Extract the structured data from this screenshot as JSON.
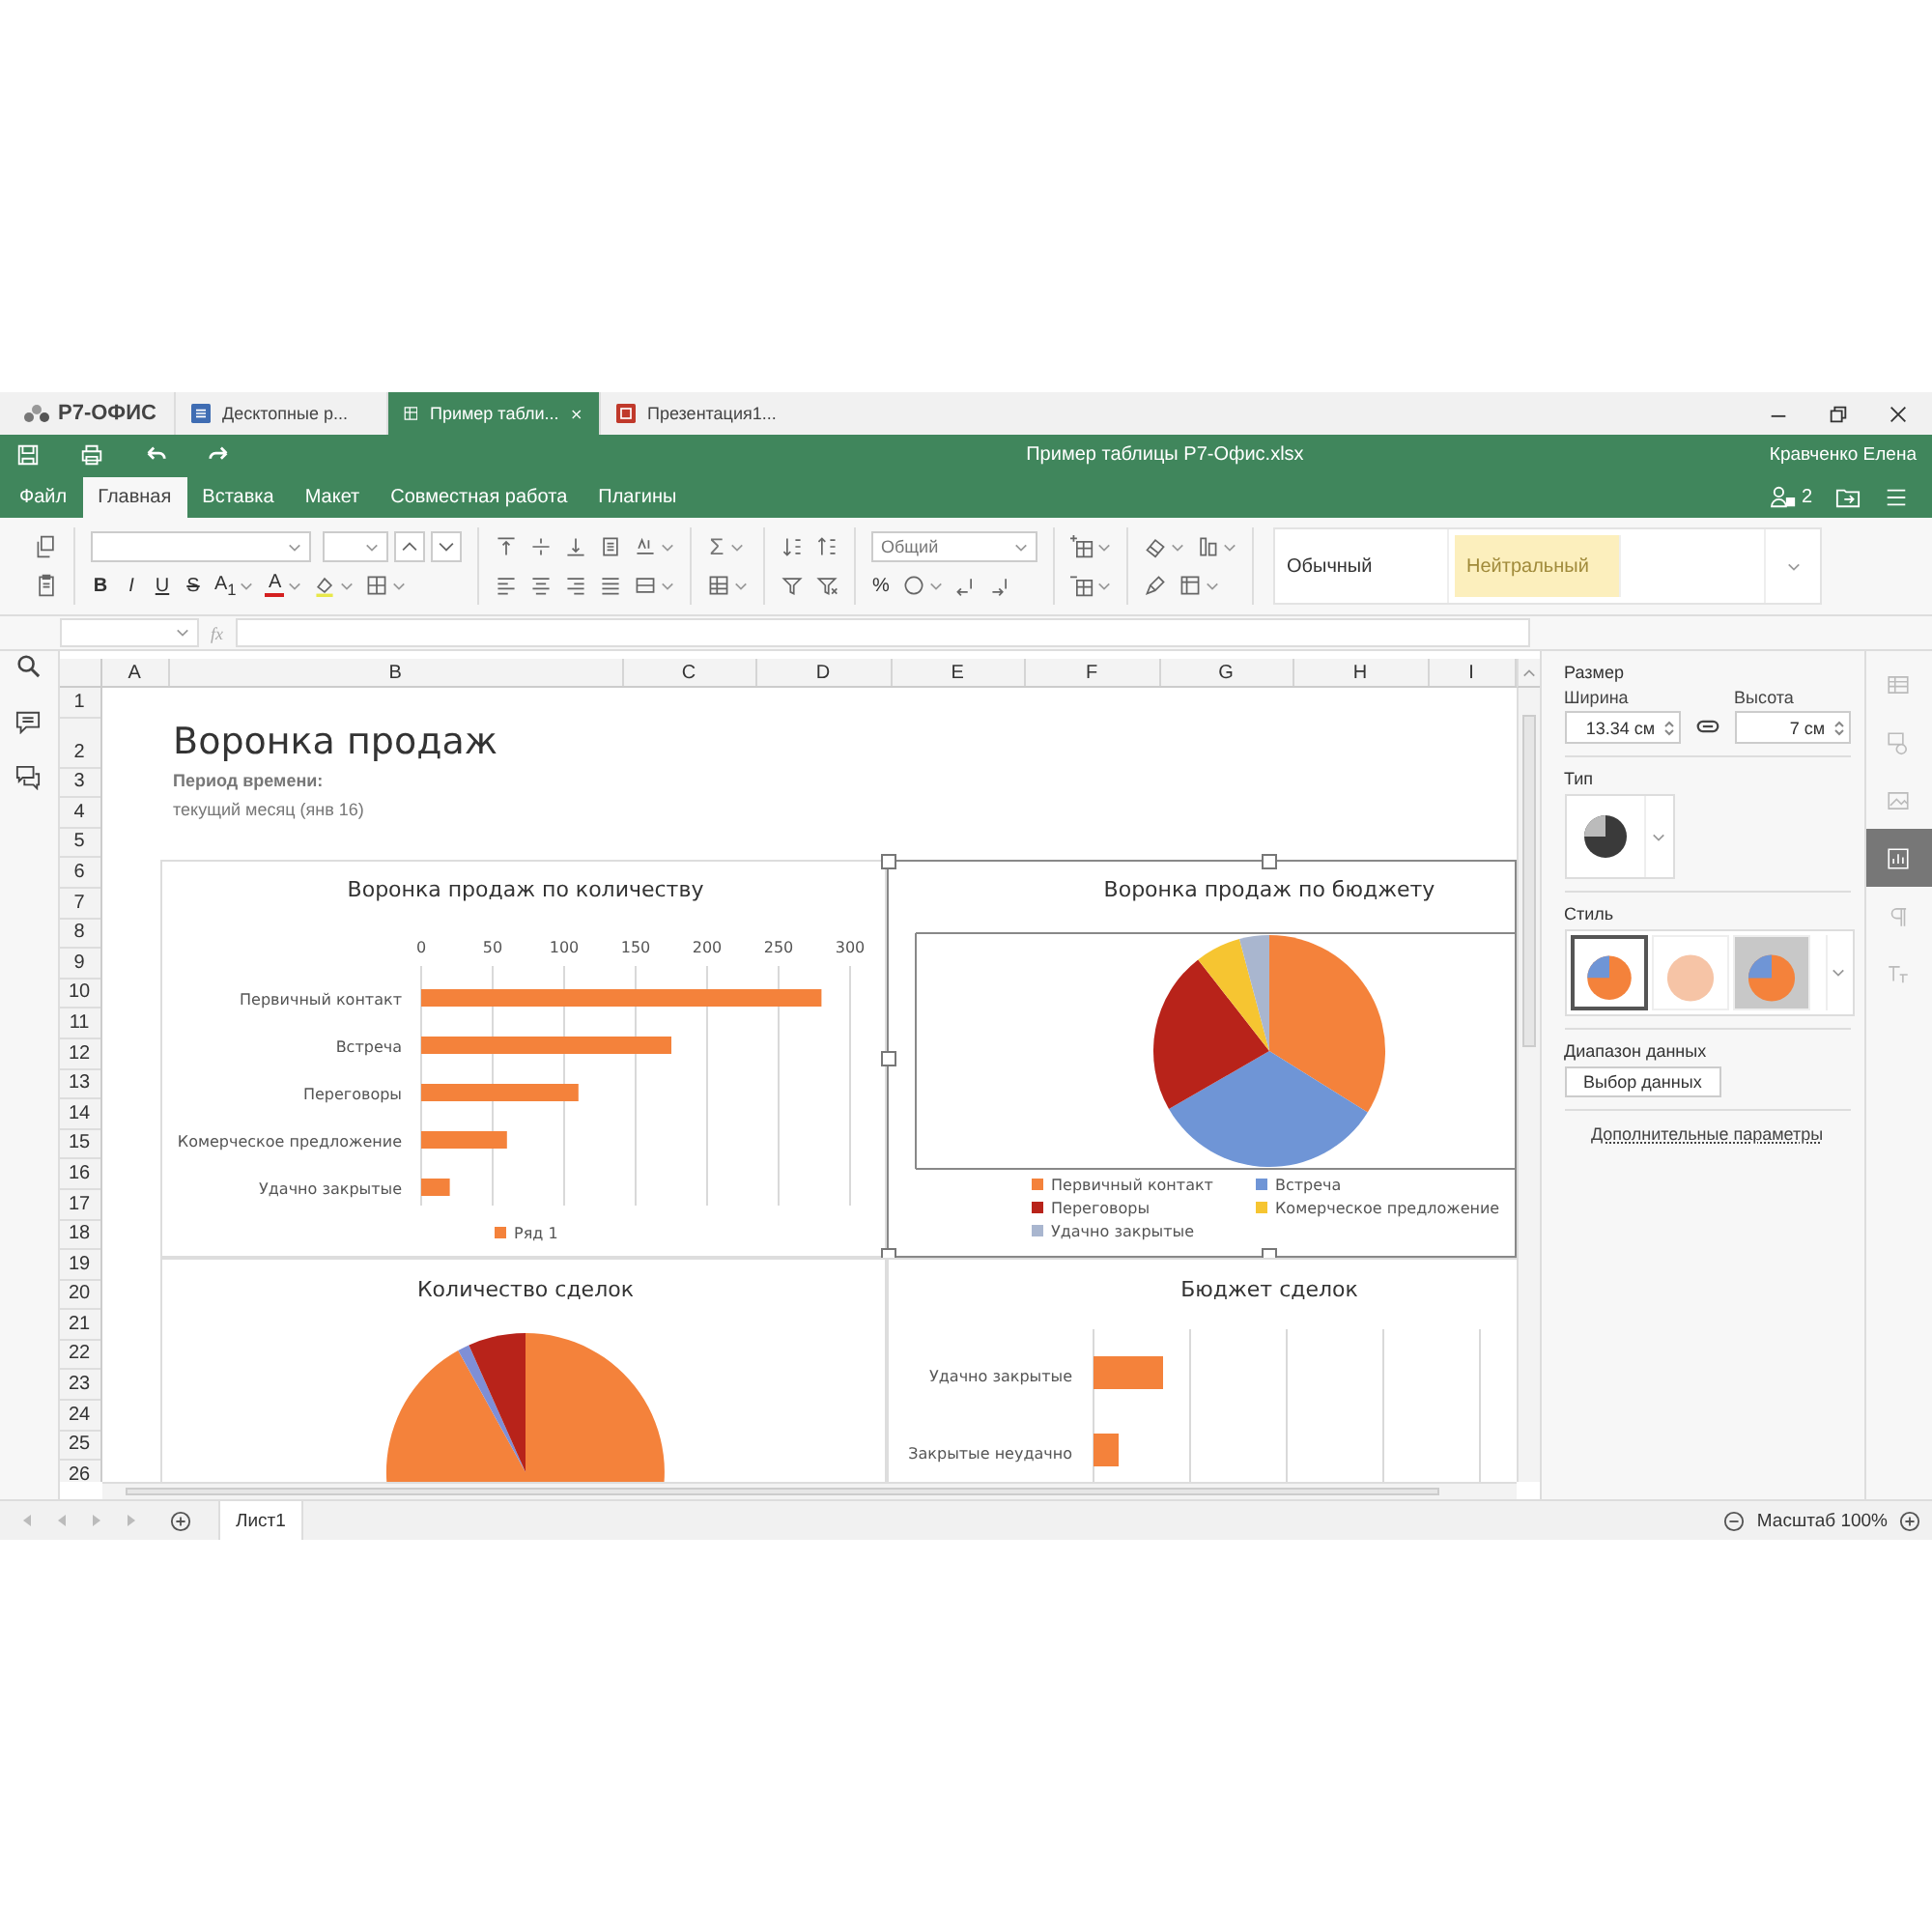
{
  "app_tabs": {
    "logo": "Р7-ОФИС",
    "tabs": [
      {
        "label": "Десктопные р...",
        "kind": "document",
        "selected": false
      },
      {
        "label": "Пример табли...",
        "kind": "spreadsheet",
        "selected": true
      },
      {
        "label": "Презентация1...",
        "kind": "presentation",
        "selected": false
      }
    ]
  },
  "title_bar": {
    "title": "Пример таблицы Р7-Офис.xlsx",
    "user": "Кравченко Елена"
  },
  "menu": [
    {
      "label": "Файл",
      "selected": false
    },
    {
      "label": "Главная",
      "selected": true
    },
    {
      "label": "Вставка",
      "selected": false
    },
    {
      "label": "Макет",
      "selected": false
    },
    {
      "label": "Совместная работа",
      "selected": false
    },
    {
      "label": "Плагины",
      "selected": false
    }
  ],
  "collaborators": "2",
  "toolbar": {
    "format_buttons": [
      {
        "label": "B",
        "kind": "bold"
      },
      {
        "label": "I",
        "kind": "italic"
      },
      {
        "label": "U",
        "kind": "underline"
      },
      {
        "label": "S",
        "kind": "strike"
      }
    ],
    "subscript": "A$_{1}$",
    "font_color": "A",
    "sum": "Σ",
    "percent": "%",
    "number_format": "Общий",
    "cell_styles": [
      {
        "label": "Обычный",
        "kind": "normal"
      },
      {
        "label": "Нейтральный",
        "kind": "neutral"
      }
    ]
  },
  "formula_bar": {
    "fx": "fx"
  },
  "sheet": {
    "columns": [
      "A",
      "B",
      "C",
      "D",
      "E",
      "F",
      "G",
      "H",
      "I"
    ],
    "rows": [
      "1",
      "2",
      "3",
      "4",
      "5",
      "6",
      "7",
      "8",
      "9",
      "10",
      "11",
      "12",
      "13",
      "14",
      "15",
      "16",
      "17",
      "18",
      "19",
      "20",
      "21",
      "22",
      "23",
      "24",
      "25",
      "26"
    ],
    "title": "Воронка продаж",
    "period_label": "Период времени:",
    "period_value": "текущий месяц (янв 16)"
  },
  "charts": [
    {
      "selected": false,
      "chart_data": {
        "type": "bar",
        "orientation": "horizontal",
        "grid": true,
        "title": "Воронка продаж по количеству",
        "categories": [
          "Первичный контакт",
          "Встреча",
          "Переговоры",
          "Комерческое предложение",
          "Удачно закрытые"
        ],
        "xlim": [
          0,
          300
        ],
        "xticks": [
          0,
          50,
          100,
          150,
          200,
          250,
          300
        ],
        "series": [
          {
            "name": "Ряд 1",
            "color": "#f4823b",
            "values": [
              280,
              175,
              110,
              60,
              20
            ]
          }
        ]
      }
    },
    {
      "kind": "pie",
      "selected": true,
      "title": "Воронка продаж по бюджету",
      "legend": [
        {
          "label": "Первичный контакт",
          "color": "#f4823b"
        },
        {
          "label": "Встреча",
          "color": "#6f95d6"
        },
        {
          "label": "Переговоры",
          "color": "#b8231a"
        },
        {
          "label": "Комерческое предложение",
          "color": "#f6c531"
        },
        {
          "label": "Удачно закрытые",
          "color": "#a9b6cf"
        }
      ]
    },
    {
      "kind": "pie_cut",
      "selected": false,
      "title": "Количество сделок"
    },
    {
      "kind": "bar_cut",
      "selected": false,
      "title": "Бюджет сделок",
      "categories": [
        "Удачно закрытые",
        "Закрытые неудачно"
      ]
    }
  ],
  "side_panel": {
    "size_label": "Размер",
    "width_label": "Ширина",
    "width": "13.34 см",
    "height_label": "Высота",
    "height": "7 см",
    "type_label": "Тип",
    "style_label": "Стиль",
    "styles": [
      {
        "kind": "flat",
        "selected": true
      },
      {
        "kind": "hatched",
        "selected": false
      },
      {
        "kind": "shaded",
        "selected": false
      }
    ],
    "range_label": "Диапазон данных",
    "range_button": "Выбор данных",
    "advanced_link": "Дополнительные параметры"
  },
  "right_tabs": [
    {
      "kind": "table",
      "selected": false
    },
    {
      "kind": "shape",
      "selected": false
    },
    {
      "kind": "image",
      "selected": false
    },
    {
      "kind": "chart",
      "selected": true
    },
    {
      "kind": "paragraph",
      "selected": false
    },
    {
      "kind": "text_art",
      "selected": false
    }
  ],
  "sheet_tabs": [
    {
      "label": "Лист1",
      "selected": true
    }
  ],
  "zoom": "Масштаб 100%"
}
